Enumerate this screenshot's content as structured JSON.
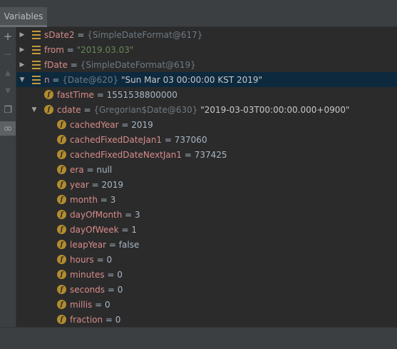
{
  "panel": {
    "tab_label": "Variables"
  },
  "toolbar": {
    "buttons": [
      {
        "icon": "plus-icon",
        "glyph": "+"
      },
      {
        "icon": "minus-icon",
        "glyph": "−"
      },
      {
        "icon": "arrow-up-icon",
        "glyph": "▲"
      },
      {
        "icon": "arrow-down-icon",
        "glyph": "▼"
      },
      {
        "icon": "copy-icon",
        "glyph": "❐"
      },
      {
        "icon": "watches-glasses-icon",
        "glyph": "∞"
      }
    ]
  },
  "tree": {
    "rows": [
      {
        "name": "sDate2",
        "eq": " = ",
        "ref": "{SimpleDateFormat@617}",
        "value": ""
      },
      {
        "name": "from",
        "eq": " = ",
        "ref": "",
        "value": "\"2019.03.03\""
      },
      {
        "name": "fDate",
        "eq": " = ",
        "ref": "{SimpleDateFormat@619}",
        "value": ""
      },
      {
        "name": "n",
        "eq": " = ",
        "ref": "{Date@620}",
        "value": " \"Sun Mar 03 00:00:00 KST 2019\""
      },
      {
        "name": "fastTime",
        "eq": " = ",
        "ref": "",
        "value": "1551538800000"
      },
      {
        "name": "cdate",
        "eq": " = ",
        "ref": "{Gregorian$Date@630}",
        "value": " \"2019-03-03T00:00:00.000+0900\""
      },
      {
        "name": "cachedYear",
        "eq": " = ",
        "ref": "",
        "value": "2019"
      },
      {
        "name": "cachedFixedDateJan1",
        "eq": " = ",
        "ref": "",
        "value": "737060"
      },
      {
        "name": "cachedFixedDateNextJan1",
        "eq": " = ",
        "ref": "",
        "value": "737425"
      },
      {
        "name": "era",
        "eq": " = ",
        "ref": "",
        "value": "null"
      },
      {
        "name": "year",
        "eq": " = ",
        "ref": "",
        "value": "2019"
      },
      {
        "name": "month",
        "eq": " = ",
        "ref": "",
        "value": "3"
      },
      {
        "name": "dayOfMonth",
        "eq": " = ",
        "ref": "",
        "value": "3"
      },
      {
        "name": "dayOfWeek",
        "eq": " = ",
        "ref": "",
        "value": "1"
      },
      {
        "name": "leapYear",
        "eq": " = ",
        "ref": "",
        "value": "false"
      },
      {
        "name": "hours",
        "eq": " = ",
        "ref": "",
        "value": "0"
      },
      {
        "name": "minutes",
        "eq": " = ",
        "ref": "",
        "value": "0"
      },
      {
        "name": "seconds",
        "eq": " = ",
        "ref": "",
        "value": "0"
      },
      {
        "name": "millis",
        "eq": " = ",
        "ref": "",
        "value": "0"
      },
      {
        "name": "fraction",
        "eq": " = ",
        "ref": "",
        "value": "0"
      }
    ]
  },
  "colors": {
    "name": "#d98b8b",
    "string": "#6a8759",
    "reference": "#6f7a83",
    "selection": "#0d293e",
    "field_icon": "#b28c2e"
  }
}
